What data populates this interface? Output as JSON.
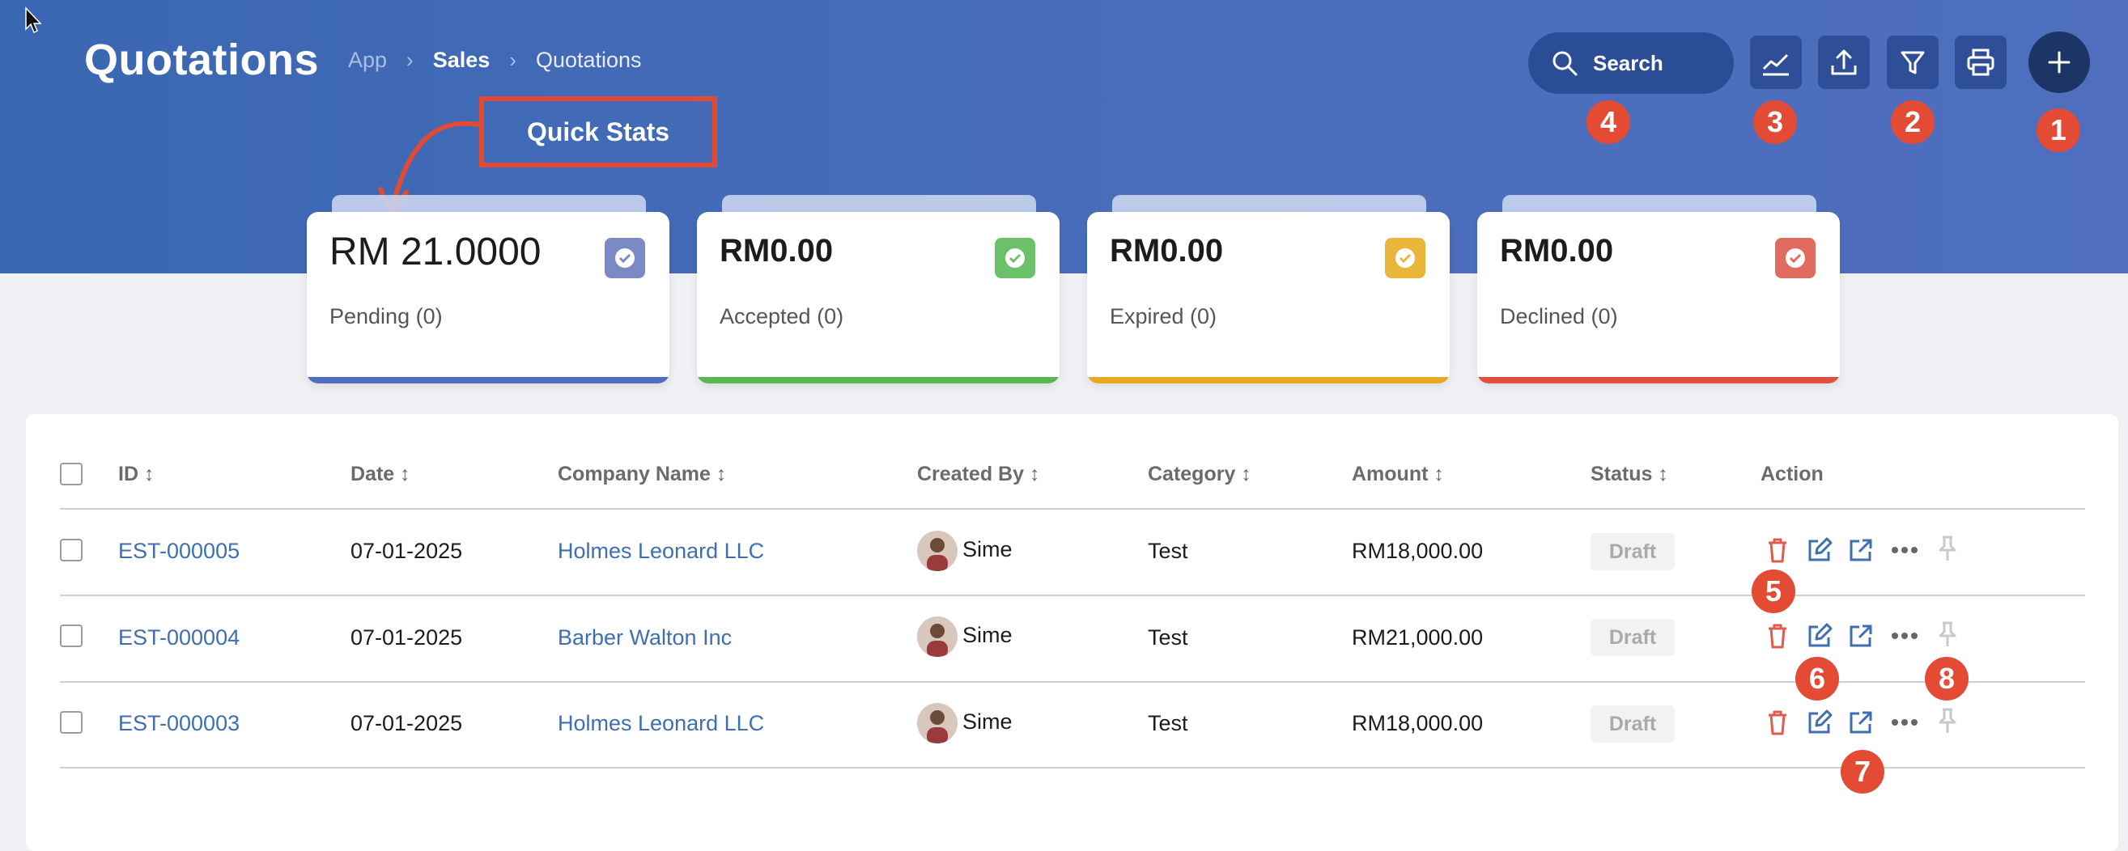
{
  "header": {
    "title": "Quotations",
    "breadcrumb": {
      "app": "App",
      "section": "Sales",
      "current": "Quotations"
    },
    "search_placeholder": "Search",
    "quick_stats_label": "Quick Stats",
    "toolbar_icons": [
      "chart-line-icon",
      "upload-icon",
      "filter-icon",
      "print-icon",
      "plus-icon"
    ]
  },
  "markers": {
    "m1": "1",
    "m2": "2",
    "m3": "3",
    "m4": "4",
    "m5": "5",
    "m6": "6",
    "m7": "7",
    "m8": "8"
  },
  "stats": [
    {
      "amount": "RM 21.0000",
      "label": "Pending (0)",
      "color": "#7b89c5"
    },
    {
      "amount": "RM0.00",
      "label": "Accepted (0)",
      "color": "#6dc06a"
    },
    {
      "amount": "RM0.00",
      "label": "Expired (0)",
      "color": "#eab63a"
    },
    {
      "amount": "RM0.00",
      "label": "Declined (0)",
      "color": "#e06b5e"
    }
  ],
  "table": {
    "columns": [
      "ID ↕",
      "Date ↕",
      "Company Name ↕",
      "Created By ↕",
      "Category ↕",
      "Amount ↕",
      "Status ↕",
      "Action"
    ],
    "rows": [
      {
        "id": "EST-000005",
        "date": "07-01-2025",
        "company": "Holmes Leonard LLC",
        "created_by": "Sime",
        "category": "Test",
        "amount": "RM18,000.00",
        "status": "Draft"
      },
      {
        "id": "EST-000004",
        "date": "07-01-2025",
        "company": "Barber Walton Inc",
        "created_by": "Sime",
        "category": "Test",
        "amount": "RM21,000.00",
        "status": "Draft"
      },
      {
        "id": "EST-000003",
        "date": "07-01-2025",
        "company": "Holmes Leonard LLC",
        "created_by": "Sime",
        "category": "Test",
        "amount": "RM18,000.00",
        "status": "Draft"
      }
    ],
    "action_icons": [
      "trash-icon",
      "edit-icon",
      "external-link-icon",
      "more-icon",
      "pin-icon"
    ]
  },
  "colors": {
    "header_bg": "#3f6ab6",
    "marker": "#e34b34",
    "link": "#3e6fb0",
    "delete": "#e05a4d"
  }
}
